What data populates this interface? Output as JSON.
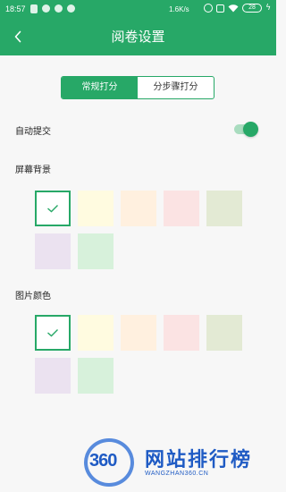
{
  "status_bar": {
    "time": "18:57",
    "speed": "1.6K/s",
    "battery": "28"
  },
  "header": {
    "title": "阅卷设置",
    "back_icon": "chevron-left-icon"
  },
  "tabs": {
    "items": [
      {
        "label": "常规打分",
        "active": true
      },
      {
        "label": "分步骤打分",
        "active": false
      }
    ]
  },
  "auto_submit": {
    "label": "自动提交",
    "enabled": true
  },
  "screen_background": {
    "label": "屏幕背景",
    "selected_index": 0,
    "colors": [
      "#ffffff",
      "#fffbe0",
      "#fff0df",
      "#fbe3e3",
      "#e3ead4",
      "#ebe2f0",
      "#d7f1db"
    ]
  },
  "image_color": {
    "label": "图片颜色",
    "selected_index": 0,
    "colors": [
      "#ffffff",
      "#fffbe0",
      "#fff0df",
      "#fbe3e3",
      "#e3ead4",
      "#ebe2f0",
      "#d7f1db"
    ]
  },
  "watermark": {
    "number": "360",
    "name": "网站排行榜",
    "site": "WANGZHAN360.CN"
  },
  "colors": {
    "accent": "#27a867"
  }
}
